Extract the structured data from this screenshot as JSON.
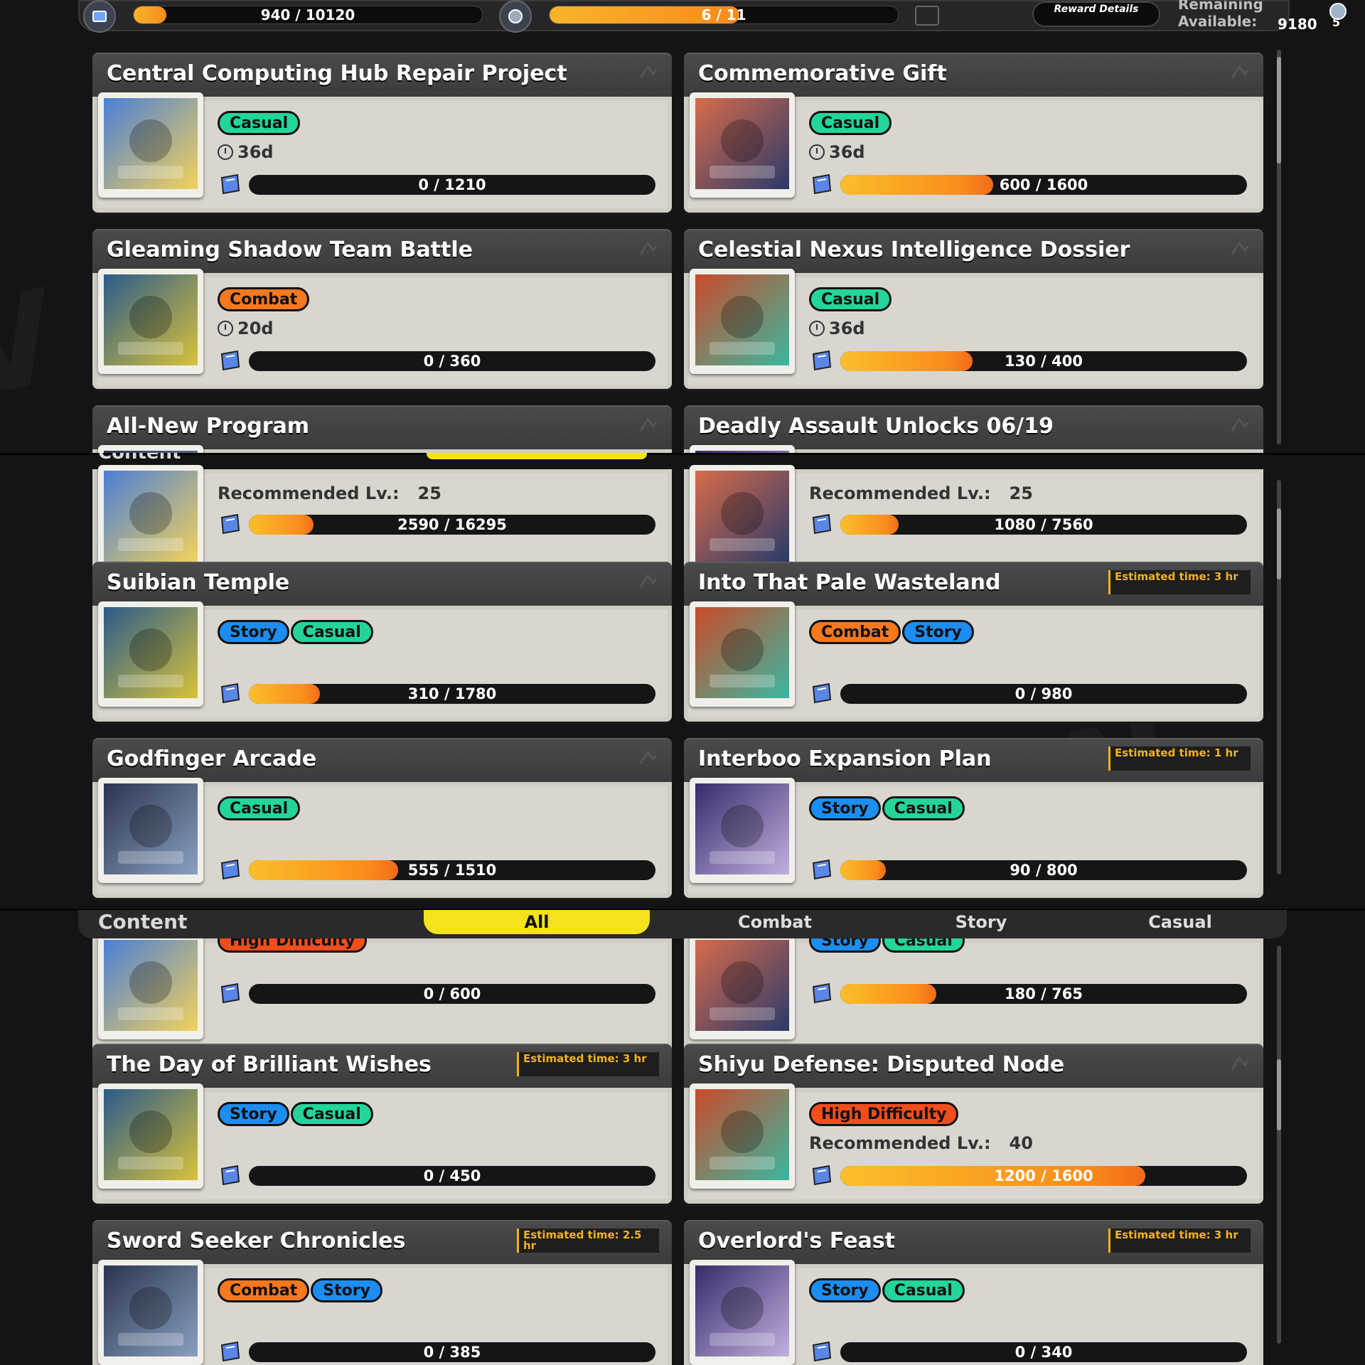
{
  "topbar": {
    "progress_label": "940 / 10120",
    "progress_value": 940,
    "progress_max": 10120,
    "level_label": "6 / 11",
    "level_value": 6,
    "level_max": 11,
    "reward_details": "Reward Details",
    "remaining_label": "Remaining Available:",
    "remaining_value": "9180",
    "gear_count": "5"
  },
  "filters": {
    "content_label": "Content",
    "tabs": [
      "All",
      "Combat",
      "Story",
      "Casual"
    ]
  },
  "section1": [
    {
      "title": "Central Computing Hub Repair Project",
      "tags": [
        {
          "label": "Casual",
          "kind": "casual"
        }
      ],
      "sub_type": "time",
      "sub": "36d",
      "progress": "0 / 1210",
      "value": 0,
      "max": 1210,
      "estimate": ""
    },
    {
      "title": "Commemorative Gift",
      "tags": [
        {
          "label": "Casual",
          "kind": "casual"
        }
      ],
      "sub_type": "time",
      "sub": "36d",
      "progress": "600 / 1600",
      "value": 600,
      "max": 1600,
      "estimate": ""
    },
    {
      "title": "Gleaming Shadow Team Battle",
      "tags": [
        {
          "label": "Combat",
          "kind": "combat"
        }
      ],
      "sub_type": "time",
      "sub": "20d",
      "progress": "0 / 360",
      "value": 0,
      "max": 360,
      "estimate": ""
    },
    {
      "title": "Celestial Nexus Intelligence Dossier",
      "tags": [
        {
          "label": "Casual",
          "kind": "casual"
        }
      ],
      "sub_type": "time",
      "sub": "36d",
      "progress": "130 / 400",
      "value": 130,
      "max": 400,
      "estimate": ""
    },
    {
      "title": "All-New Program",
      "tags": [],
      "sub_type": "none",
      "sub": "",
      "progress": "",
      "value": 0,
      "max": 1,
      "estimate": ""
    },
    {
      "title": "Deadly Assault Unlocks 06/19",
      "tags": [],
      "sub_type": "none",
      "sub": "",
      "progress": "",
      "value": 0,
      "max": 1,
      "estimate": ""
    }
  ],
  "section2": [
    {
      "title": "",
      "tags": [],
      "sub_type": "level",
      "sub_label": "Recommended Lv.:",
      "sub": "25",
      "progress": "2590 / 16295",
      "value": 2590,
      "max": 16295,
      "estimate": ""
    },
    {
      "title": "",
      "tags": [],
      "sub_type": "level",
      "sub_label": "Recommended Lv.:",
      "sub": "25",
      "progress": "1080 / 7560",
      "value": 1080,
      "max": 7560,
      "estimate": ""
    },
    {
      "title": "Suibian Temple",
      "tags": [
        {
          "label": "Story",
          "kind": "story"
        },
        {
          "label": "Casual",
          "kind": "casual"
        }
      ],
      "sub_type": "none",
      "sub": "",
      "progress": "310 / 1780",
      "value": 310,
      "max": 1780,
      "estimate": ""
    },
    {
      "title": "Into That Pale Wasteland",
      "tags": [
        {
          "label": "Combat",
          "kind": "combat"
        },
        {
          "label": "Story",
          "kind": "story"
        }
      ],
      "sub_type": "none",
      "sub": "",
      "progress": "0 / 980",
      "value": 0,
      "max": 980,
      "estimate": "Estimated time: 3 hr"
    },
    {
      "title": "Godfinger Arcade",
      "tags": [
        {
          "label": "Casual",
          "kind": "casual"
        }
      ],
      "sub_type": "none",
      "sub": "",
      "progress": "555 / 1510",
      "value": 555,
      "max": 1510,
      "estimate": ""
    },
    {
      "title": "Interboo Expansion Plan",
      "tags": [
        {
          "label": "Story",
          "kind": "story"
        },
        {
          "label": "Casual",
          "kind": "casual"
        }
      ],
      "sub_type": "none",
      "sub": "",
      "progress": "90 / 800",
      "value": 90,
      "max": 800,
      "estimate": "Estimated time: 1 hr"
    }
  ],
  "section3": [
    {
      "title": "",
      "tags": [
        {
          "label": "High Difficulty",
          "kind": "high"
        }
      ],
      "sub_type": "none",
      "sub": "",
      "progress": "0 / 600",
      "value": 0,
      "max": 600,
      "estimate": ""
    },
    {
      "title": "",
      "tags": [
        {
          "label": "Story",
          "kind": "story"
        },
        {
          "label": "Casual",
          "kind": "casual"
        }
      ],
      "sub_type": "none",
      "sub": "",
      "progress": "180 / 765",
      "value": 180,
      "max": 765,
      "estimate": ""
    },
    {
      "title": "The Day of Brilliant Wishes",
      "tags": [
        {
          "label": "Story",
          "kind": "story"
        },
        {
          "label": "Casual",
          "kind": "casual"
        }
      ],
      "sub_type": "none",
      "sub": "",
      "progress": "0 / 450",
      "value": 0,
      "max": 450,
      "estimate": "Estimated time: 3 hr"
    },
    {
      "title": "Shiyu Defense: Disputed Node",
      "tags": [
        {
          "label": "High Difficulty",
          "kind": "high"
        }
      ],
      "sub_type": "level",
      "sub_label": "Recommended Lv.:",
      "sub": "40",
      "progress": "1200 / 1600",
      "value": 1200,
      "max": 1600,
      "estimate": ""
    },
    {
      "title": "Sword Seeker Chronicles",
      "tags": [
        {
          "label": "Combat",
          "kind": "combat"
        },
        {
          "label": "Story",
          "kind": "story"
        }
      ],
      "sub_type": "none",
      "sub": "",
      "progress": "0 / 385",
      "value": 0,
      "max": 385,
      "estimate": "Estimated time: 2.5 hr"
    },
    {
      "title": "Overlord's Feast",
      "tags": [
        {
          "label": "Story",
          "kind": "story"
        },
        {
          "label": "Casual",
          "kind": "casual"
        }
      ],
      "sub_type": "none",
      "sub": "",
      "progress": "0 / 340",
      "value": 0,
      "max": 340,
      "estimate": "Estimated time: 3 hr"
    }
  ],
  "colors": {
    "casual": "#23d59a",
    "combat": "#f7781e",
    "story": "#1c8df2",
    "high": "#f24d1d",
    "accent": "#f4e21c",
    "estimate": "#f2b21a"
  }
}
